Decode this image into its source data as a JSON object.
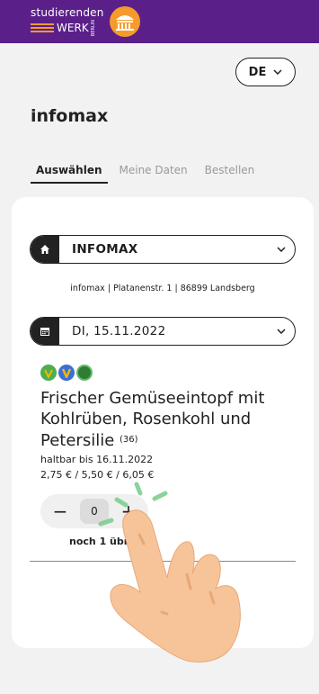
{
  "header": {
    "logo_line1": "studierenden",
    "logo_line2": "WERK",
    "logo_berlin": "BERLIN"
  },
  "language": {
    "selected": "DE"
  },
  "page": {
    "title": "infomax"
  },
  "tabs": [
    {
      "label": "Auswählen",
      "active": true
    },
    {
      "label": "Meine Daten",
      "active": false
    },
    {
      "label": "Bestellen",
      "active": false
    }
  ],
  "location": {
    "name": "INFOMAX",
    "address": "infomax | Platanenstr. 1 | 86899 Landsberg"
  },
  "date": {
    "value": "DI, 15.11.2022"
  },
  "meal": {
    "badges": [
      "vegan-wheat-icon",
      "vegetarian-icon",
      "climate-icon"
    ],
    "title": "Frischer Gemüseeintopf mit Kohlrüben, Rosenkohl und Petersilie",
    "allergen_code": "(36)",
    "best_before": "haltbar bis 16.11.2022",
    "prices": "2,75 € / 5,50 € / 6,05 €",
    "quantity": "0",
    "minus": "−",
    "plus": "+",
    "remaining": "noch 1 übrig"
  },
  "colors": {
    "header_bg": "#5b1f8a",
    "brand_orange": "#f59b2b",
    "badge_green": "#4caf50",
    "badge_gold": "#f2b705",
    "badge_blue": "#3a6fd8"
  }
}
